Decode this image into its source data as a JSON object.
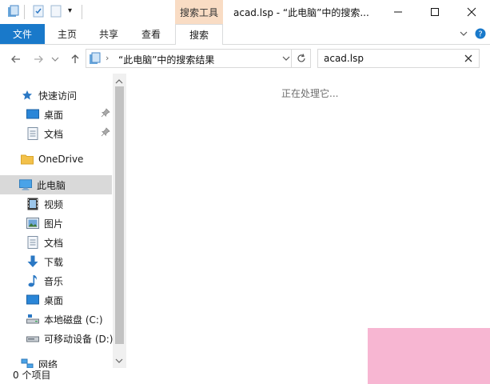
{
  "title_bar": {
    "context_tab": "搜索工具",
    "window_title": "acad.lsp - “此电脑”中的搜索...",
    "qat_dropdown": "▾"
  },
  "ribbon": {
    "file": "文件",
    "tabs": [
      "主页",
      "共享",
      "查看",
      "搜索"
    ]
  },
  "address_bar": {
    "path": "“此电脑”中的搜索结果",
    "search_value": "acad.lsp"
  },
  "nav": {
    "quick_access": "快速访问",
    "quick_items": [
      "桌面",
      "文档"
    ],
    "onedrive": "OneDrive",
    "this_pc": "此电脑",
    "pc_items": [
      "视频",
      "图片",
      "文档",
      "下载",
      "音乐",
      "桌面",
      "本地磁盘 (C:)",
      "可移动设备 (D:)"
    ],
    "network": "网络"
  },
  "content": {
    "status_text": "正在处理它..."
  },
  "status_bar": {
    "item_count": "0 个项目"
  },
  "colors": {
    "file_tab": "#1979ca",
    "context_tab": "#f9dcc4",
    "selection": "#d9d9d9",
    "folder": "#f3c14a",
    "accent_blue": "#2b78c4"
  }
}
